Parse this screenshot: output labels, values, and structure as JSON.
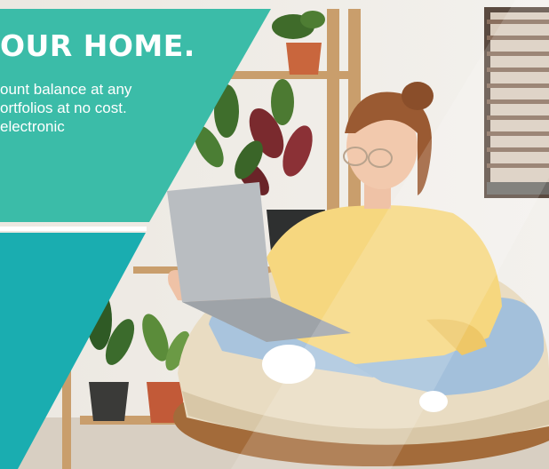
{
  "banner": {
    "headline": "OUR HOME.",
    "body_lines": [
      "ount balance at any",
      "ortfolios at no cost.",
      "electronic"
    ]
  },
  "colors": {
    "panel_teal_light": "#3bbca8",
    "panel_teal_dark": "#1aadb0",
    "text": "#ffffff",
    "accent_shirt": "#f4d57a",
    "accent_laptop": "#b8bcc0"
  },
  "illustration": {
    "subject": "woman-with-laptop-on-papasan-chair",
    "icons": [
      "plant-icon",
      "laptop-icon",
      "chair-icon",
      "shelf-icon",
      "window-blinds-icon"
    ]
  }
}
